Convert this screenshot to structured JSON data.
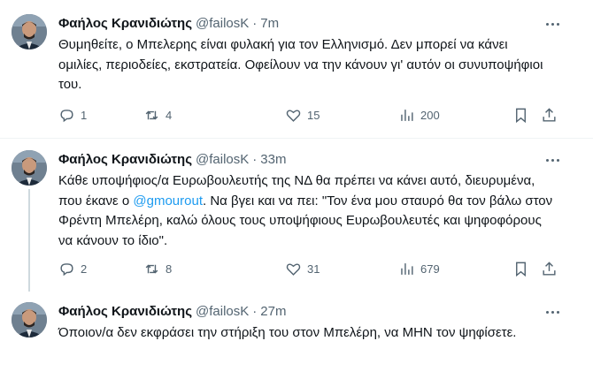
{
  "tweets": [
    {
      "name": "Φαήλος Κρανιδιώτης",
      "handle": "@failosK",
      "dot": "·",
      "time": "7m",
      "text": "Θυμηθείτε, ο Μπελερης είναι φυλακή για τον Ελληνισμό. Δεν μπορεί να κάνει ομιλίες, περιοδείες, εκστρατεία. Οφείλουν να την κάνουν γι' αυτόν οι συνυποψήφιοι του.",
      "replies": "1",
      "reposts": "4",
      "likes": "15",
      "views": "200"
    },
    {
      "name": "Φαήλος Κρανιδιώτης",
      "handle": "@failosK",
      "dot": "·",
      "time": "33m",
      "text_before": "Κάθε υποψήφιος/α Ευρωβουλευτής της ΝΔ θα πρέπει να κάνει αυτό, διευρυμένα, που έκανε ο ",
      "mention": "@gmourout",
      "text_after": ". Να βγει και να πει: \"Τον ένα μου σταυρό θα τον βάλω στον Φρέντη Μπελέρη, καλώ όλους τους υποψήφιους Ευρωβουλευτές και ψηφοφόρους να κάνουν το ίδιο\".",
      "replies": "2",
      "reposts": "8",
      "likes": "31",
      "views": "679"
    },
    {
      "name": "Φαήλος Κρανιδιώτης",
      "handle": "@failosK",
      "dot": "·",
      "time": "27m",
      "text": "Όποιον/α δεν εκφράσει την στήριξη του στον Μπελέρη, να ΜΗΝ τον ψηφίσετε."
    }
  ],
  "icons": {
    "reply": "reply-icon",
    "repost": "repost-icon",
    "like": "heart-icon",
    "views": "views-icon",
    "bookmark": "bookmark-icon",
    "share": "share-icon",
    "more": "more-icon"
  },
  "colors": {
    "link": "#1d9bf0",
    "secondary": "#536471",
    "text": "#0f1419"
  }
}
